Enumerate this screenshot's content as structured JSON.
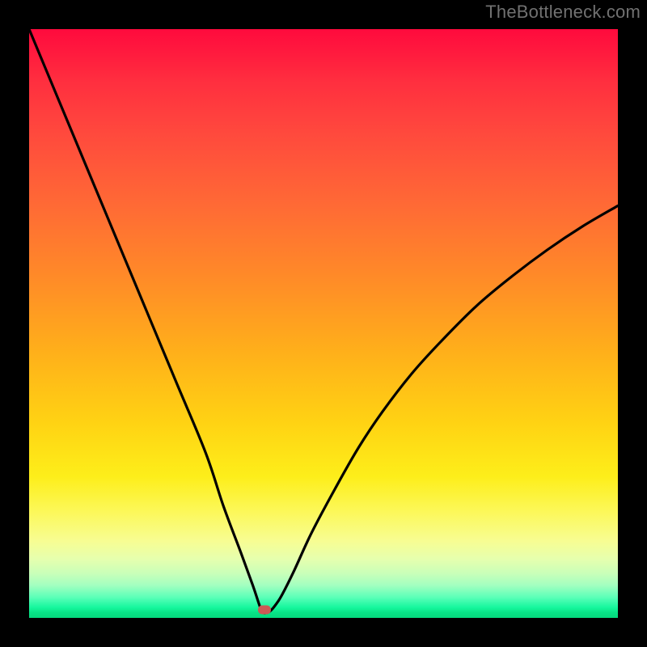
{
  "watermark": "TheBottleneck.com",
  "chart_data": {
    "type": "line",
    "title": "",
    "xlabel": "",
    "ylabel": "",
    "xlim": [
      0,
      100
    ],
    "ylim": [
      0,
      100
    ],
    "grid": false,
    "legend": false,
    "series": [
      {
        "name": "curve",
        "x": [
          0,
          5,
          10,
          15,
          20,
          25,
          30,
          33,
          36,
          38,
          39,
          39.5,
          40,
          41,
          42,
          43,
          45,
          48,
          52,
          56,
          60,
          65,
          70,
          76,
          82,
          88,
          94,
          100
        ],
        "y": [
          100,
          88,
          76,
          64,
          52,
          40,
          28,
          19,
          11,
          5.5,
          2.5,
          1.2,
          0.8,
          1.2,
          2.4,
          4,
          8,
          14.5,
          22,
          29,
          35,
          41.5,
          47,
          53,
          58,
          62.5,
          66.5,
          70
        ]
      }
    ],
    "marker": {
      "x": 40,
      "y": 1.4
    },
    "colors": {
      "curve_stroke": "#000000",
      "marker_fill": "#cc5a55",
      "frame_bg": "#000000"
    }
  }
}
